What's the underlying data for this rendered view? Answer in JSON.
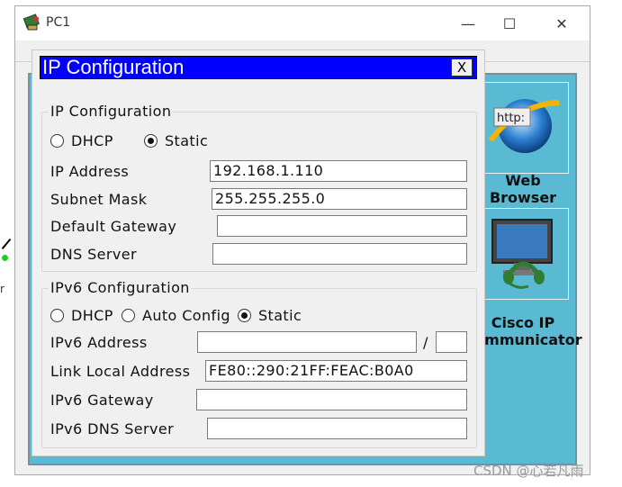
{
  "window": {
    "title": "PC1",
    "minimize_glyph": "—",
    "maximize_glyph": "☐",
    "close_glyph": "✕"
  },
  "desktop": {
    "apps": [
      {
        "label_line1": "Web",
        "label_line2": "Browser",
        "icon": "web-browser-icon",
        "icon_text": "http:"
      },
      {
        "label_line1": "Cisco IP",
        "label_line2": "Communicator",
        "icon": "cisco-ip-communicator-icon"
      }
    ],
    "left_clip_text": "r"
  },
  "dialog": {
    "title": "IP Configuration",
    "close_label": "X",
    "ipv4": {
      "legend": "IP Configuration",
      "dhcp_label": "DHCP",
      "static_label": "Static",
      "mode": "Static",
      "ip_address_label": "IP Address",
      "ip_address": "192.168.1.110",
      "subnet_mask_label": "Subnet Mask",
      "subnet_mask": "255.255.255.0",
      "default_gateway_label": "Default Gateway",
      "default_gateway": "",
      "dns_server_label": "DNS Server",
      "dns_server": ""
    },
    "ipv6": {
      "legend": "IPv6 Configuration",
      "dhcp_label": "DHCP",
      "auto_config_label": "Auto Config",
      "static_label": "Static",
      "mode": "Static",
      "address_label": "IPv6 Address",
      "address": "",
      "prefix_separator": "/",
      "prefix": "",
      "link_local_label": "Link Local Address",
      "link_local": "FE80::290:21FF:FEAC:B0A0",
      "gateway_label": "IPv6 Gateway",
      "gateway": "",
      "dns_server_label": "IPv6 DNS Server",
      "dns_server": ""
    }
  },
  "watermark": "CSDN @心若凡雨"
}
